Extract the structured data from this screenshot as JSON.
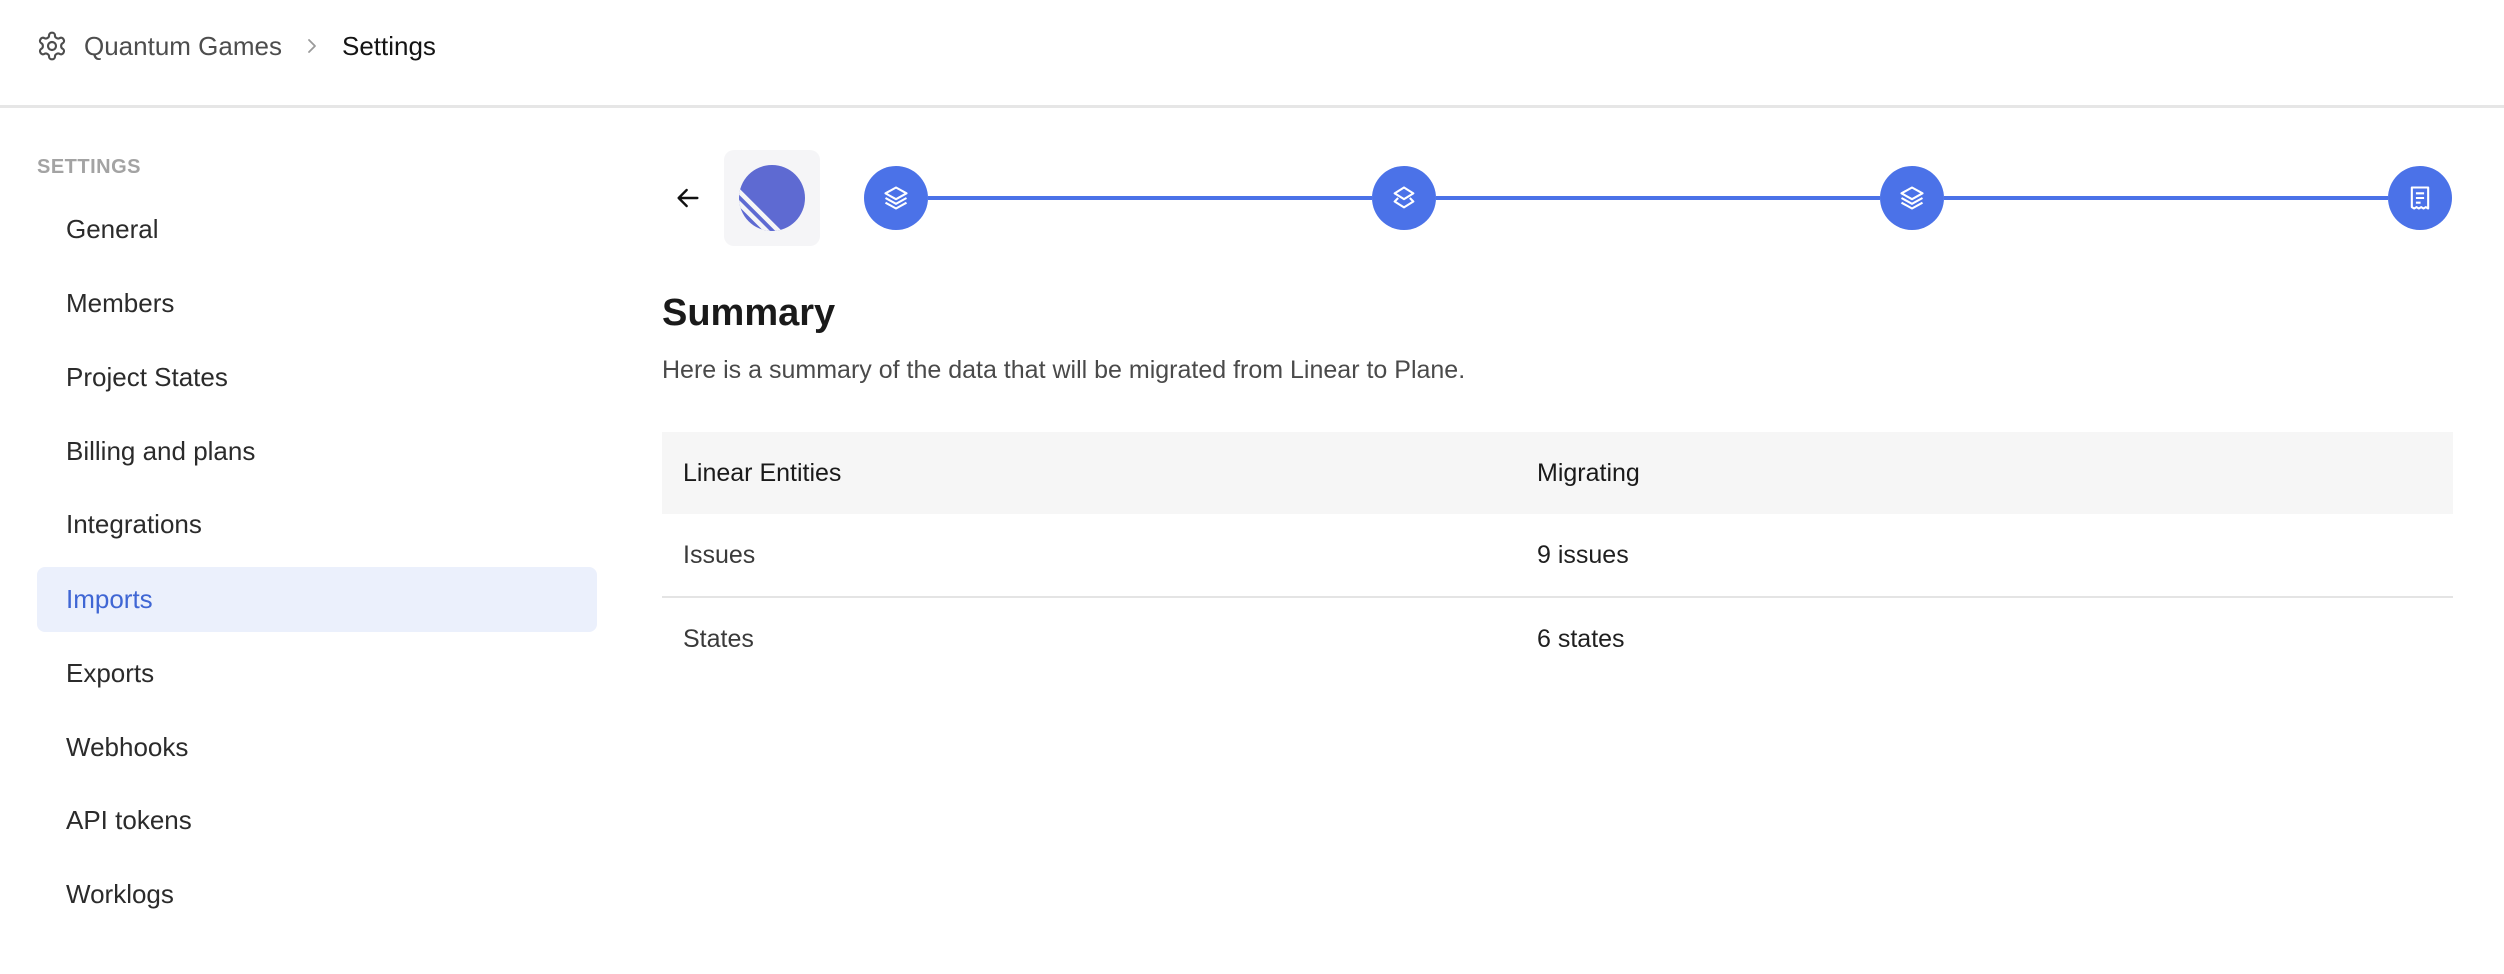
{
  "header": {
    "icon": "gear-icon",
    "breadcrumb": [
      "Quantum Games",
      "Settings"
    ]
  },
  "sidebar": {
    "title": "SETTINGS",
    "items": [
      {
        "label": "General",
        "active": false
      },
      {
        "label": "Members",
        "active": false
      },
      {
        "label": "Project States",
        "active": false
      },
      {
        "label": "Billing and plans",
        "active": false
      },
      {
        "label": "Integrations",
        "active": false
      },
      {
        "label": "Imports",
        "active": true
      },
      {
        "label": "Exports",
        "active": false
      },
      {
        "label": "Webhooks",
        "active": false
      },
      {
        "label": "API tokens",
        "active": false
      },
      {
        "label": "Worklogs",
        "active": false
      }
    ]
  },
  "importer": {
    "service_logo": "linear-logo",
    "steps": [
      {
        "icon": "layers-icon",
        "status": "complete"
      },
      {
        "icon": "layers-icon",
        "status": "complete"
      },
      {
        "icon": "layers-icon",
        "status": "complete"
      },
      {
        "icon": "receipt-icon",
        "status": "current"
      }
    ],
    "accent": "#4b72e8"
  },
  "summary": {
    "title": "Summary",
    "description": "Here is a summary of the data that will be migrated from Linear to Plane.",
    "table": {
      "headers": [
        "Linear Entities",
        "Migrating"
      ],
      "rows": [
        [
          "Issues",
          "9 issues"
        ],
        [
          "States",
          "6 states"
        ]
      ]
    }
  }
}
